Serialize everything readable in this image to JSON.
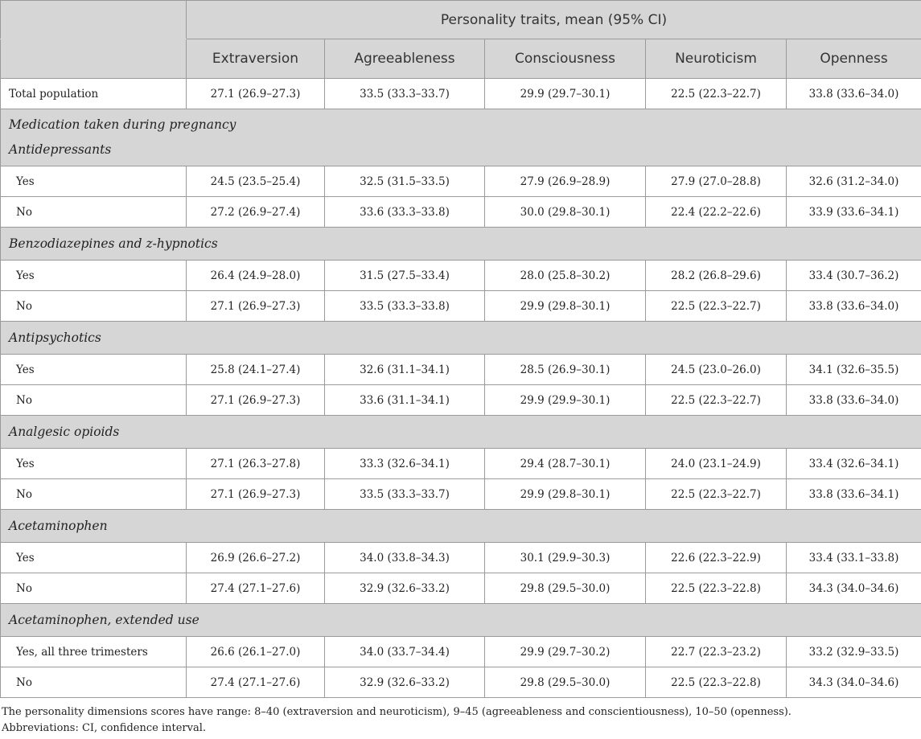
{
  "header": {
    "group_title": "Personality traits, mean (95% CI)",
    "columns": [
      "Extraversion",
      "Agreeableness",
      "Consciousness",
      "Neuroticism",
      "Openness"
    ]
  },
  "total": {
    "label": "Total population",
    "values": [
      "27.1 (26.9–27.3)",
      "33.5 (33.3–33.7)",
      "29.9 (29.7–30.1)",
      "22.5 (22.3–22.7)",
      "33.8 (33.6–34.0)"
    ]
  },
  "medication_heading": "Medication taken during pregnancy",
  "sections": [
    {
      "title": "Antidepressants",
      "rows": [
        {
          "label": "Yes",
          "values": [
            "24.5 (23.5–25.4)",
            "32.5 (31.5–33.5)",
            "27.9 (26.9–28.9)",
            "27.9 (27.0–28.8)",
            "32.6 (31.2–34.0)"
          ]
        },
        {
          "label": "No",
          "values": [
            "27.2 (26.9–27.4)",
            "33.6 (33.3–33.8)",
            "30.0 (29.8–30.1)",
            "22.4 (22.2–22.6)",
            "33.9 (33.6–34.1)"
          ]
        }
      ]
    },
    {
      "title": "Benzodiazepines and z-hypnotics",
      "rows": [
        {
          "label": "Yes",
          "values": [
            "26.4 (24.9–28.0)",
            "31.5 (27.5–33.4)",
            "28.0 (25.8–30.2)",
            "28.2 (26.8–29.6)",
            "33.4 (30.7–36.2)"
          ]
        },
        {
          "label": "No",
          "values": [
            "27.1 (26.9–27.3)",
            "33.5 (33.3–33.8)",
            "29.9 (29.8–30.1)",
            "22.5 (22.3–22.7)",
            "33.8 (33.6–34.0)"
          ]
        }
      ]
    },
    {
      "title": "Antipsychotics",
      "rows": [
        {
          "label": "Yes",
          "values": [
            "25.8 (24.1–27.4)",
            "32.6 (31.1–34.1)",
            "28.5 (26.9–30.1)",
            "24.5 (23.0–26.0)",
            "34.1 (32.6–35.5)"
          ]
        },
        {
          "label": "No",
          "values": [
            "27.1 (26.9–27.3)",
            "33.6 (31.1–34.1)",
            "29.9 (29.9–30.1)",
            "22.5 (22.3–22.7)",
            "33.8 (33.6–34.0)"
          ]
        }
      ]
    },
    {
      "title": "Analgesic opioids",
      "rows": [
        {
          "label": "Yes",
          "values": [
            "27.1 (26.3–27.8)",
            "33.3 (32.6–34.1)",
            "29.4 (28.7–30.1)",
            "24.0 (23.1–24.9)",
            "33.4 (32.6–34.1)"
          ]
        },
        {
          "label": "No",
          "values": [
            "27.1 (26.9–27.3)",
            "33.5 (33.3–33.7)",
            "29.9 (29.8–30.1)",
            "22.5 (22.3–22.7)",
            "33.8 (33.6–34.1)"
          ]
        }
      ]
    },
    {
      "title": "Acetaminophen",
      "rows": [
        {
          "label": "Yes",
          "values": [
            "26.9 (26.6–27.2)",
            "34.0 (33.8–34.3)",
            "30.1 (29.9–30.3)",
            "22.6 (22.3–22.9)",
            "33.4 (33.1–33.8)"
          ]
        },
        {
          "label": "No",
          "values": [
            "27.4 (27.1–27.6)",
            "32.9 (32.6–33.2)",
            "29.8 (29.5–30.0)",
            "22.5 (22.3–22.8)",
            "34.3 (34.0–34.6)"
          ]
        }
      ]
    },
    {
      "title": "Acetaminophen, extended use",
      "rows": [
        {
          "label": "Yes, all three trimesters",
          "values": [
            "26.6 (26.1–27.0)",
            "34.0 (33.7–34.4)",
            "29.9 (29.7–30.2)",
            "22.7 (22.3–23.2)",
            "33.2 (32.9–33.5)"
          ]
        },
        {
          "label": "No",
          "values": [
            "27.4 (27.1–27.6)",
            "32.9 (32.6–33.2)",
            "29.8 (29.5–30.0)",
            "22.5 (22.3–22.8)",
            "34.3 (34.0–34.6)"
          ]
        }
      ]
    }
  ],
  "footnotes": [
    "The personality dimensions scores have range: 8–40 (extraversion and neuroticism), 9–45 (agreeableness and conscientiousness), 10–50 (openness).",
    "Abbreviations: CI, confidence interval."
  ]
}
